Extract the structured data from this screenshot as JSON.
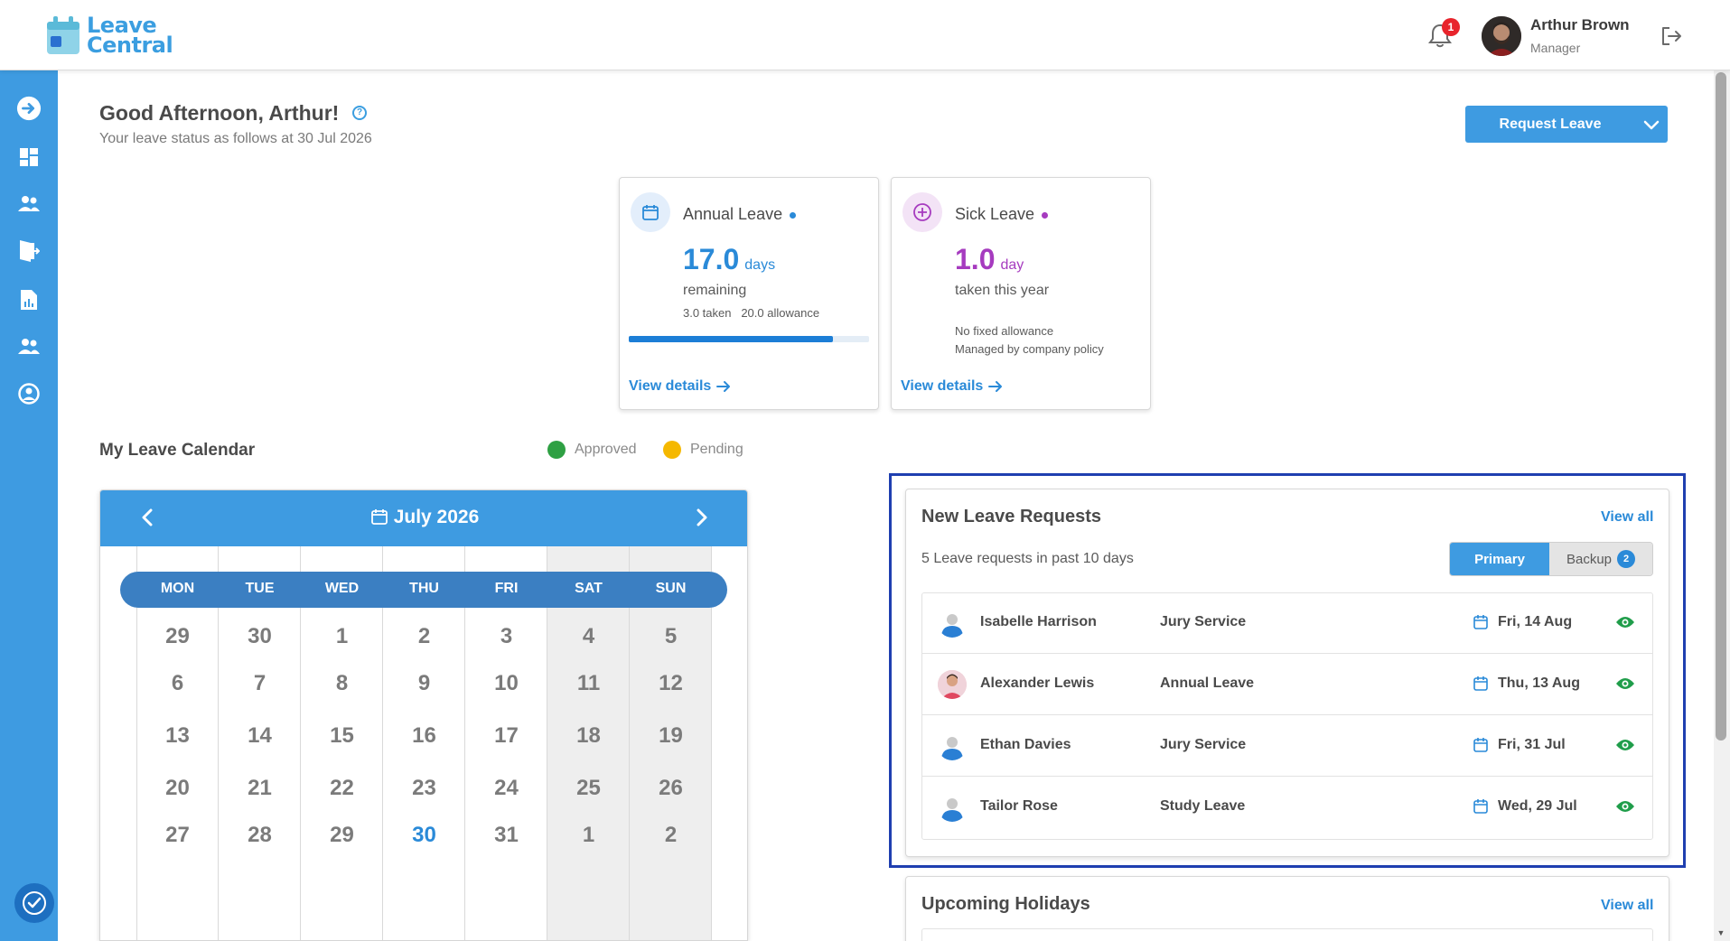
{
  "brand": {
    "line1": "Leave",
    "line2": "Central"
  },
  "header": {
    "notification_count": "1",
    "user_name": "Arthur Brown",
    "user_role": "Manager"
  },
  "sidebar": {
    "items": [
      {
        "icon": "arrow-right-circle-icon"
      },
      {
        "icon": "dashboard-icon"
      },
      {
        "icon": "team-icon"
      },
      {
        "icon": "leave-door-icon"
      },
      {
        "icon": "report-icon"
      },
      {
        "icon": "people-icon"
      },
      {
        "icon": "profile-icon"
      }
    ],
    "bottom_icon": "accessibility-icon"
  },
  "greeting": {
    "title": "Good Afternoon, Arthur!",
    "subtitle": "Your leave status as follows at 30 Jul 2026"
  },
  "request_button": {
    "label": "Request Leave"
  },
  "cards": {
    "annual": {
      "title": "Annual Leave",
      "value": "17.0",
      "unit": "days",
      "line1": "remaining",
      "line2": "3.0 taken   20.0 allowance",
      "progress": 0.85,
      "link": "View details",
      "color": "#2a8ad8"
    },
    "sick": {
      "title": "Sick Leave",
      "value": "1.0",
      "unit": "day",
      "line1": "taken this year",
      "line2": "No fixed allowance",
      "line3": "Managed by company policy",
      "link": "View details",
      "color": "#a63bbf"
    }
  },
  "calendar": {
    "title": "My Leave Calendar",
    "legend": {
      "approved": "Approved",
      "pending": "Pending"
    },
    "legend_colors": {
      "approved": "#2ea043",
      "pending": "#f5b800"
    },
    "month": "July 2026",
    "weekdays": [
      "MON",
      "TUE",
      "WED",
      "THU",
      "FRI",
      "SAT",
      "SUN"
    ],
    "weeks": [
      [
        "29",
        "30",
        "1",
        "2",
        "3",
        "4",
        "5"
      ],
      [
        "6",
        "7",
        "8",
        "9",
        "10",
        "11",
        "12"
      ],
      [
        "13",
        "14",
        "15",
        "16",
        "17",
        "18",
        "19"
      ],
      [
        "20",
        "21",
        "22",
        "23",
        "24",
        "25",
        "26"
      ],
      [
        "27",
        "28",
        "29",
        "30",
        "31",
        "1",
        "2"
      ]
    ],
    "today": "30"
  },
  "requests": {
    "title": "New Leave Requests",
    "view_all": "View all",
    "subtitle": "5 Leave requests in past 10 days",
    "tab_primary": "Primary",
    "tab_backup": "Backup",
    "backup_count": "2",
    "rows": [
      {
        "name": "Isabelle Harrison",
        "type": "Jury Service",
        "date": "Fri, 14 Aug"
      },
      {
        "name": "Alexander Lewis",
        "type": "Annual Leave",
        "date": "Thu, 13 Aug"
      },
      {
        "name": "Ethan Davies",
        "type": "Jury Service",
        "date": "Fri, 31 Jul"
      },
      {
        "name": "Tailor Rose",
        "type": "Study Leave",
        "date": "Wed, 29 Jul"
      }
    ]
  },
  "holidays": {
    "title": "Upcoming Holidays",
    "view_all": "View all"
  }
}
